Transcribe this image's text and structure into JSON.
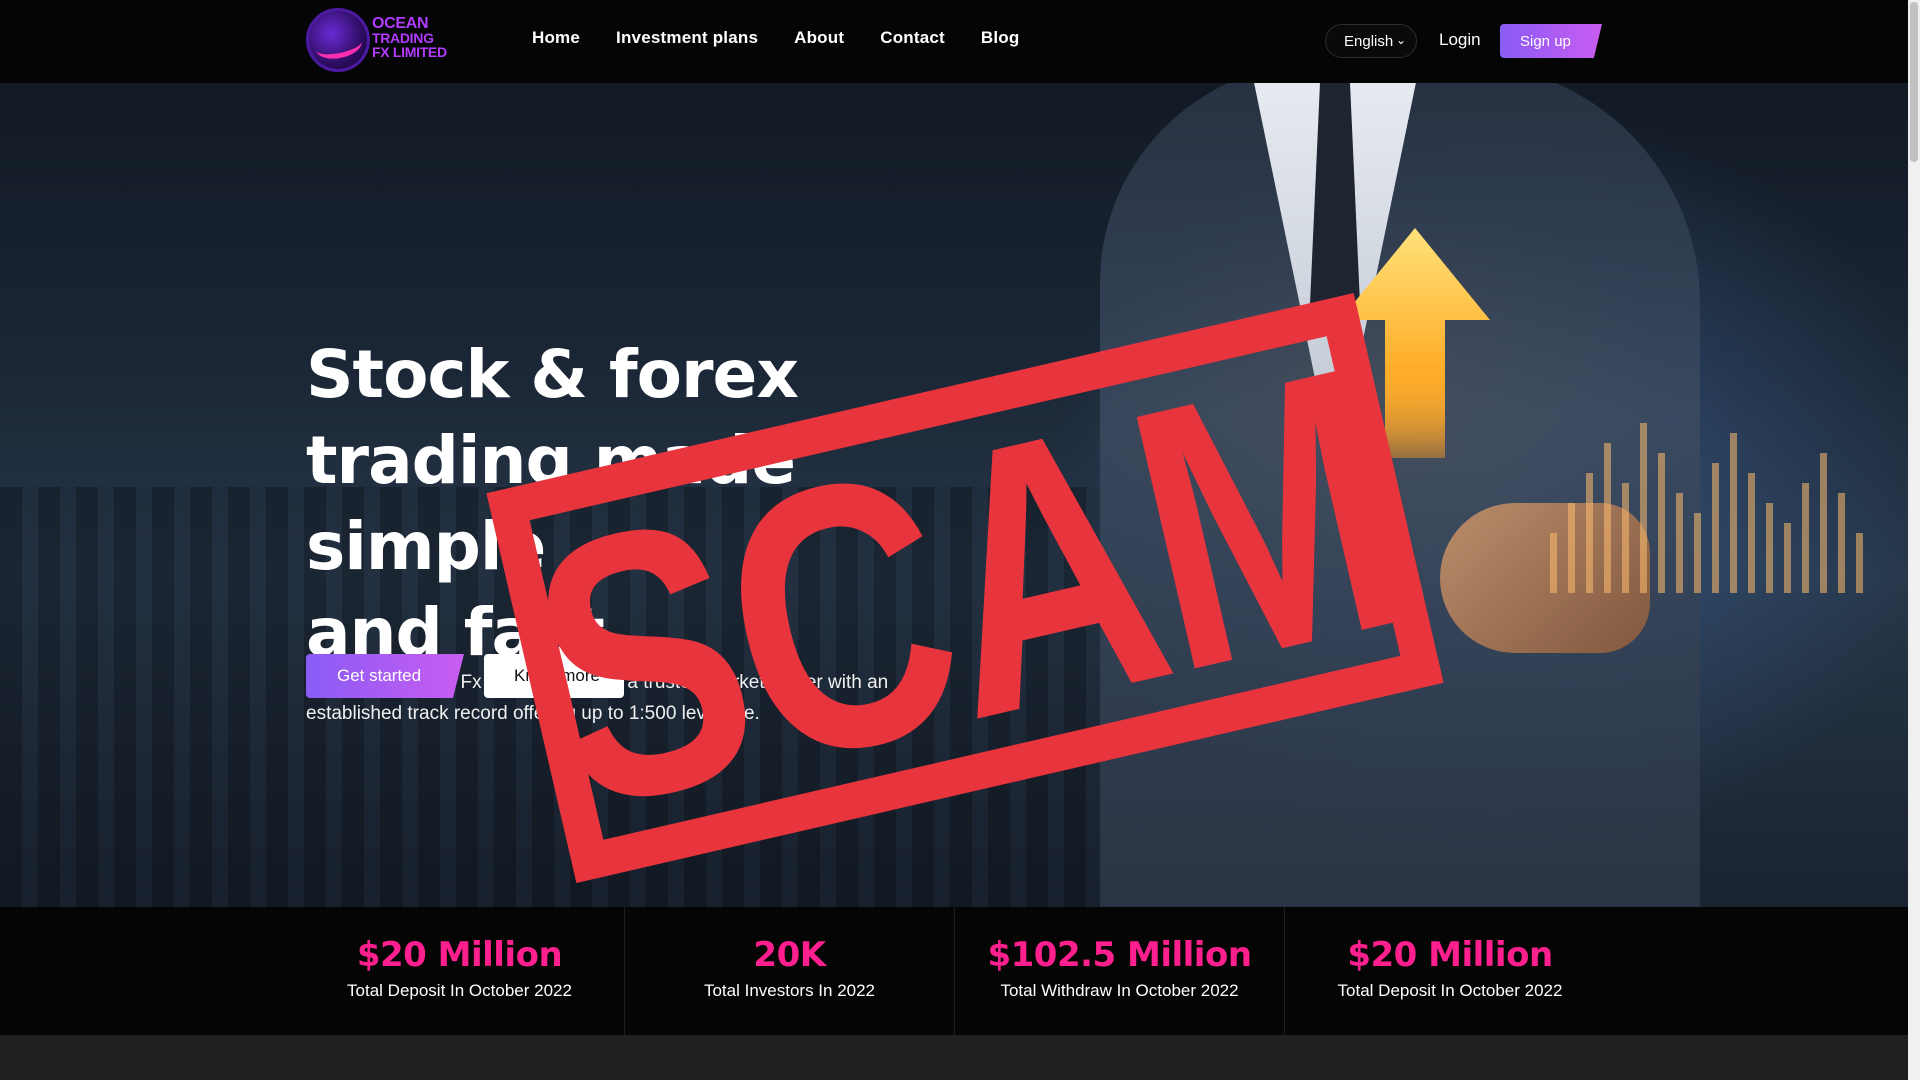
{
  "brand": {
    "logo_lines": [
      "OCEAN",
      "TRADING",
      "FX LIMITED"
    ]
  },
  "nav": {
    "items": [
      "Home",
      "Investment plans",
      "About",
      "Contact",
      "Blog"
    ]
  },
  "header": {
    "language_selected": "English",
    "login_label": "Login",
    "signup_label": "Sign up"
  },
  "hero": {
    "title_lines": [
      "Stock & forex",
      "trading made simple",
      "and fast"
    ],
    "description": "Trade with Ocean Fx Trading Limited, a trusted market leader with an established track record offering up to 1:500 leverage.",
    "primary_button": "Get started",
    "secondary_button": "Know more"
  },
  "overlay": {
    "stamp_text": "SCAM",
    "stamp_color": "#e8343c"
  },
  "stats": [
    {
      "value": "$20 Million",
      "label": "Total Deposit In October 2022"
    },
    {
      "value": "20K",
      "label": "Total Investors In 2022"
    },
    {
      "value": "$102.5 Million",
      "label": "Total Withdraw In October 2022"
    },
    {
      "value": "$20 Million",
      "label": "Total Deposit In October 2022"
    }
  ],
  "colors": {
    "accent_pink": "#ff1f8e",
    "button_gradient_start": "#8a5cf6",
    "button_gradient_end": "#c95cf0",
    "header_bg": "#050505"
  }
}
